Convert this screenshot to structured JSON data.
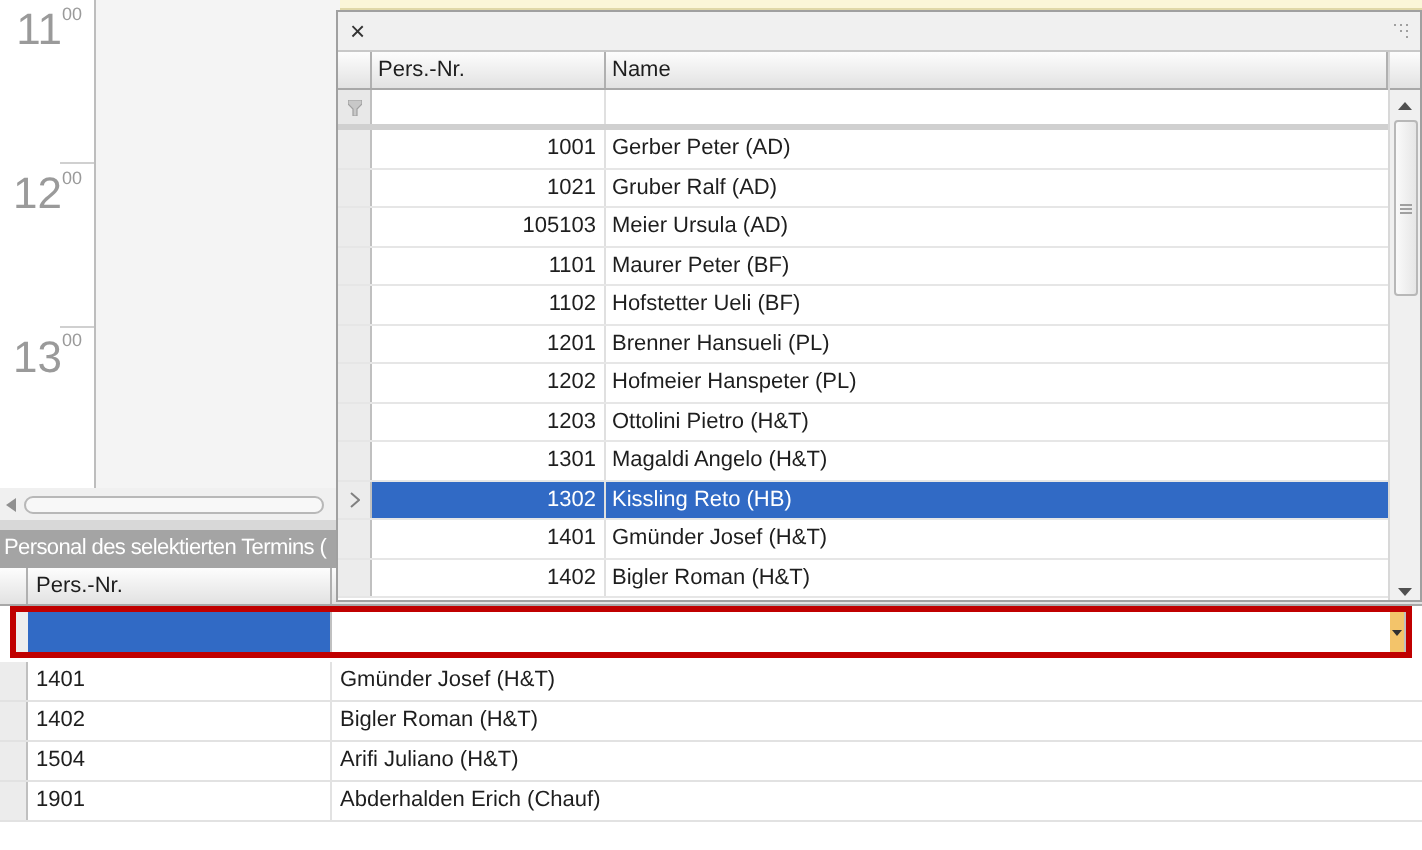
{
  "calendar": {
    "hours": [
      "11$^{00}$",
      "12$^{00}$",
      "13$^{00}$"
    ]
  },
  "personnel_panel": {
    "title": "Personal des selektierten Termins (",
    "columns": [
      "Pers.-Nr."
    ],
    "filter_cells": [
      {
        "selected": true
      },
      {
        "selected": false
      }
    ],
    "rows": [
      {
        "number": "1401",
        "name": "Gmünder Josef (H&T)"
      },
      {
        "number": "1402",
        "name": "Bigler Roman (H&T)"
      },
      {
        "number": "1504",
        "name": "Arifi Juliano (H&T)"
      },
      {
        "number": "1901",
        "name": "Abderhalden Erich (Chauf)"
      }
    ]
  },
  "dropdown": {
    "close": "×",
    "columns": [
      "Pers.-Nr.",
      "Name"
    ],
    "rows": [
      {
        "number": "1001",
        "name": "Gerber Peter (AD)",
        "selected": false
      },
      {
        "number": "1021",
        "name": "Gruber Ralf (AD)",
        "selected": false
      },
      {
        "number": "105103",
        "name": "Meier Ursula (AD)",
        "selected": false
      },
      {
        "number": "1101",
        "name": "Maurer Peter (BF)",
        "selected": false
      },
      {
        "number": "1102",
        "name": "Hofstetter Ueli (BF)",
        "selected": false
      },
      {
        "number": "1201",
        "name": "Brenner Hansueli (PL)",
        "selected": false
      },
      {
        "number": "1202",
        "name": "Hofmeier Hanspeter (PL)",
        "selected": false
      },
      {
        "number": "1203",
        "name": "Ottolini Pietro (H&T)",
        "selected": false
      },
      {
        "number": "1301",
        "name": "Magaldi Angelo (H&T)",
        "selected": false
      },
      {
        "number": "1302",
        "name": "Kissling Reto (HB)",
        "selected": true
      },
      {
        "number": "1401",
        "name": "Gmünder Josef (H&T)",
        "selected": false
      },
      {
        "number": "1402",
        "name": "Bigler Roman (H&T)",
        "selected": false
      }
    ]
  }
}
